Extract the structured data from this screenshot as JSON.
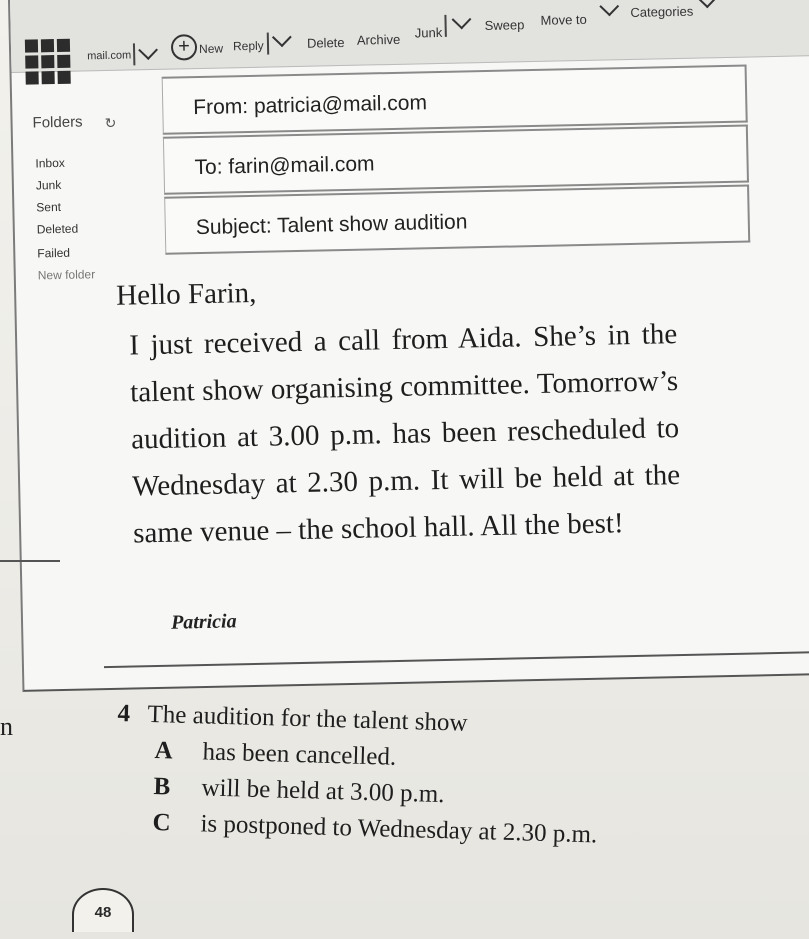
{
  "toolbar": {
    "app": "mail.com",
    "new": "New",
    "reply": "Reply",
    "delete": "Delete",
    "archive": "Archive",
    "junk": "Junk",
    "sweep": "Sweep",
    "move_to": "Move to",
    "categories": "Categories",
    "more": "..."
  },
  "sidebar": {
    "title": "Folders",
    "items": [
      "Inbox",
      "Junk",
      "Sent",
      "Deleted",
      "Failed",
      "New folder"
    ]
  },
  "email": {
    "from": "From: patricia@mail.com",
    "to": "To: farin@mail.com",
    "subject": "Subject: Talent show audition",
    "greeting": "Hello Farin,",
    "body": "I just received a call from Aida. She’s in the talent show organising committee. Tomorrow’s audition at 3.00 p.m. has been rescheduled to Wednesday at 2.30 p.m. It will be held at the same venue – the school hall. All the best!",
    "signature": "Patricia"
  },
  "question": {
    "number": "4",
    "stem": "The audition for the talent show",
    "options": [
      {
        "letter": "A",
        "text": "has been cancelled."
      },
      {
        "letter": "B",
        "text": "will be held at 3.00 p.m."
      },
      {
        "letter": "C",
        "text": "is postponed to Wednesday at 2.30 p.m."
      }
    ]
  },
  "margin_letter": "n",
  "page_number": "48"
}
